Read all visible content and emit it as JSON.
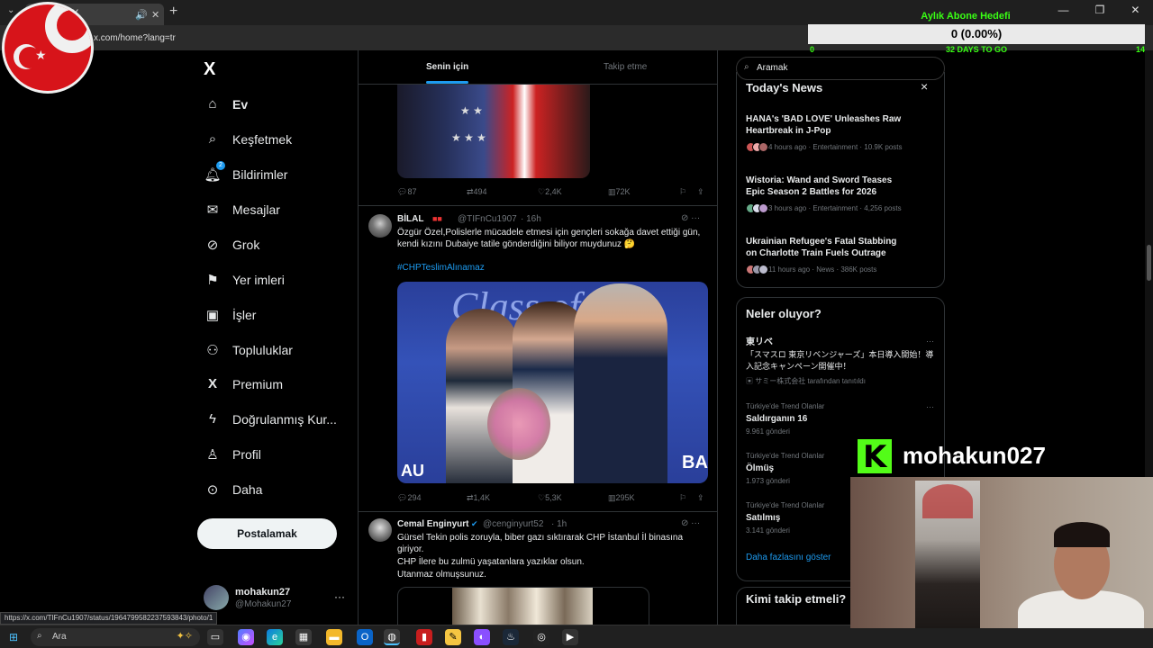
{
  "browser": {
    "tab_title": "X",
    "url": "x.com/home?lang=tr",
    "new_tab_label": "+",
    "status_link": "https://x.com/TIFnCu1907/status/1964799582237593843/photo/1"
  },
  "overlay": {
    "sub_goal_title": "Aylık Abone Hedefi",
    "sub_goal_value": "0 (0.00%)",
    "sub_goal_min": "0",
    "sub_goal_days": "32 DAYS TO GO",
    "sub_goal_max": "14",
    "streamer_name": "mohakun027"
  },
  "nav": {
    "logo": "X",
    "items": [
      {
        "label": "Ev",
        "icon": "home-icon"
      },
      {
        "label": "Keşfetmek",
        "icon": "search-icon"
      },
      {
        "label": "Bildirimler",
        "icon": "bell-icon",
        "badge": "2"
      },
      {
        "label": "Mesajlar",
        "icon": "mail-icon"
      },
      {
        "label": "Grok",
        "icon": "grok-icon"
      },
      {
        "label": "Yer imleri",
        "icon": "bookmark-icon"
      },
      {
        "label": "İşler",
        "icon": "briefcase-icon"
      },
      {
        "label": "Topluluklar",
        "icon": "people-icon"
      },
      {
        "label": "Premium",
        "icon": "x-icon"
      },
      {
        "label": "Doğrulanmış Kur...",
        "icon": "lightning-icon"
      },
      {
        "label": "Profil",
        "icon": "person-icon"
      },
      {
        "label": "Daha",
        "icon": "more-circle-icon"
      }
    ],
    "post_label": "Postalamak",
    "me_name": "mohakun27",
    "me_handle": "@Mohakun27",
    "me_dots": "···"
  },
  "timeline": {
    "tab_foryou": "Senin için",
    "tab_following": "Takip etme",
    "tweet0_actions": {
      "replies": "87",
      "reposts": "494",
      "likes": "2,4K",
      "views": "72K"
    },
    "tweet1": {
      "name": "BİLAL",
      "handle": "@TIFnCu1907",
      "time": "· 16h",
      "text": "Özgür Özel,Polislerle mücadele etmesi için gençleri sokağa davet ettiği gün, kendi kızını Dubaiye tatile gönderdiğini biliyor muydunuz 🤔",
      "tag": "#CHPTeslimAlınamaz",
      "replies": "294",
      "reposts": "1,4K",
      "likes": "5,3K",
      "views": "295K"
    },
    "tweet2": {
      "name": "Cemal Enginyurt",
      "handle": "@cenginyurt52",
      "time": "· 1h",
      "text1": "Gürsel Tekin polis zoruyla, biber gazı sıktırarak CHP İstanbul İl binasına giriyor.",
      "text2": "CHP İlere bu zulmü yaşatanlara yazıklar olsun.",
      "text3": "Utanmaz olmuşsunuz."
    }
  },
  "right": {
    "search_value": "Aramak",
    "news_title": "Today's News",
    "close": "×",
    "news": [
      {
        "title": "HANA's 'BAD LOVE' Unleashes Raw Heartbreak in J-Pop",
        "meta": "4 hours ago · Entertainment · 10.9K posts"
      },
      {
        "title": "Wistoria: Wand and Sword Teases Epic Season 2 Battles for 2026",
        "meta": "3 hours ago · Entertainment · 4,256 posts"
      },
      {
        "title": "Ukrainian Refugee's Fatal Stabbing on Charlotte Train Fuels Outrage",
        "meta": "11 hours ago · News · 386K posts"
      }
    ],
    "trends_title": "Neler oluyor?",
    "trend_ad": {
      "name": "東リベ",
      "text": "「スマスロ 東京リベンジャーズ」本日導入開始！導入記念キャンペーン開催中！",
      "promo": "サミー株式会社 tarafından tanıtıldı"
    },
    "trends": [
      {
        "context": "Türkiye'de Trend Olanlar",
        "name": "Saldırganın 16",
        "count": "9.961 gönderi"
      },
      {
        "context": "Türkiye'de Trend Olanlar",
        "name": "Ölmüş",
        "count": "1.973 gönderi"
      },
      {
        "context": "Türkiye'de Trend Olanlar",
        "name": "Satılmış",
        "count": "3.141 gönderi"
      }
    ],
    "show_more": "Daha fazlasını göster",
    "who_to_follow": "Kimi takip etmeli?"
  },
  "taskbar": {
    "search_placeholder": "Ara"
  }
}
